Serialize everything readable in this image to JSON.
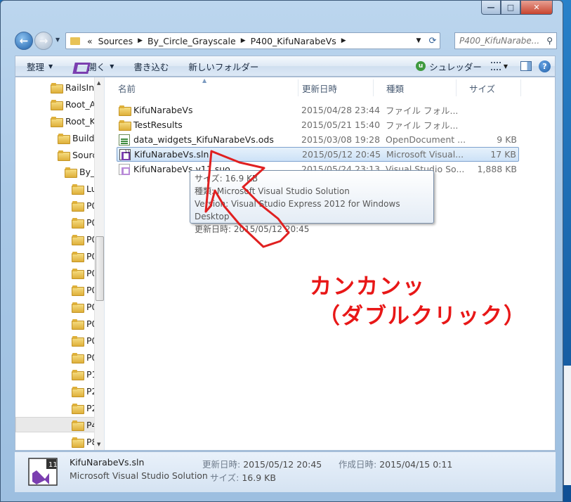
{
  "window": {
    "caption_buttons": {
      "minimize": "—",
      "maximize": "□",
      "close": "✕"
    }
  },
  "nav": {
    "back_icon": "back-arrow-icon",
    "forward_icon": "forward-arrow-icon",
    "breadcrumbs": [
      "«",
      "Sources",
      "By_Circle_Grayscale",
      "P400_KifuNarabeVs"
    ],
    "search_placeholder": "P400_KifuNarabe..."
  },
  "toolbar": {
    "organize": "整理",
    "open": "開く",
    "burn": "書き込む",
    "new_folder": "新しいフォルダー",
    "shredder": "シュレッダー"
  },
  "tree": {
    "items": [
      {
        "label": "RailsIn"
      },
      {
        "label": "Root_A"
      },
      {
        "label": "Root_K"
      },
      {
        "label": "Builds"
      },
      {
        "label": "Sourc"
      },
      {
        "label": "By_"
      },
      {
        "label": "Lu"
      },
      {
        "label": "P0"
      },
      {
        "label": "P0"
      },
      {
        "label": "P0"
      },
      {
        "label": "P0"
      },
      {
        "label": "P0"
      },
      {
        "label": "P0"
      },
      {
        "label": "P0"
      },
      {
        "label": "P0"
      },
      {
        "label": "P0"
      },
      {
        "label": "P1"
      },
      {
        "label": "P2"
      },
      {
        "label": "P2"
      },
      {
        "label": "P4"
      },
      {
        "label": "P8"
      }
    ]
  },
  "columns": {
    "name": "名前",
    "date": "更新日時",
    "type": "種類",
    "size": "サイズ"
  },
  "files": [
    {
      "name": "KifuNarabeVs",
      "date": "2015/04/28 23:44",
      "type": "ファイル フォル...",
      "size": "",
      "icon": "folder"
    },
    {
      "name": "TestResults",
      "date": "2015/05/21 15:40",
      "type": "ファイル フォル...",
      "size": "",
      "icon": "folder"
    },
    {
      "name": "data_widgets_KifuNarabeVs.ods",
      "date": "2015/03/08 19:28",
      "type": "OpenDocument ...",
      "size": "9 KB",
      "icon": "ods"
    },
    {
      "name": "KifuNarabeVs.sln",
      "date": "2015/05/12 20:45",
      "type": "Microsoft Visual...",
      "size": "17 KB",
      "icon": "sln"
    },
    {
      "name": "KifuNarabeVs.v11.suo",
      "date": "2015/05/24 23:13",
      "type": "Visual Studio So...",
      "size": "1,888 KB",
      "icon": "suo"
    }
  ],
  "tooltip": {
    "lines": [
      "サイズ: 16.9 KB",
      "種類: Microsoft Visual Studio Solution",
      "Version: Visual Studio Express 2012 for Windows Desktop",
      "更新日時: 2015/05/12 20:45"
    ]
  },
  "annotation": {
    "line1": "カンカンッ",
    "line2": "（ダブルクリック）",
    "color": "#e81717"
  },
  "details": {
    "filename": "KifuNarabeVs.sln",
    "filetype": "Microsoft Visual Studio Solution",
    "modified_label": "更新日時:",
    "modified_value": "2015/05/12 20:45",
    "created_label": "作成日時:",
    "created_value": "2015/04/15 0:11",
    "size_label": "サイズ:",
    "size_value": "16.9 KB"
  }
}
